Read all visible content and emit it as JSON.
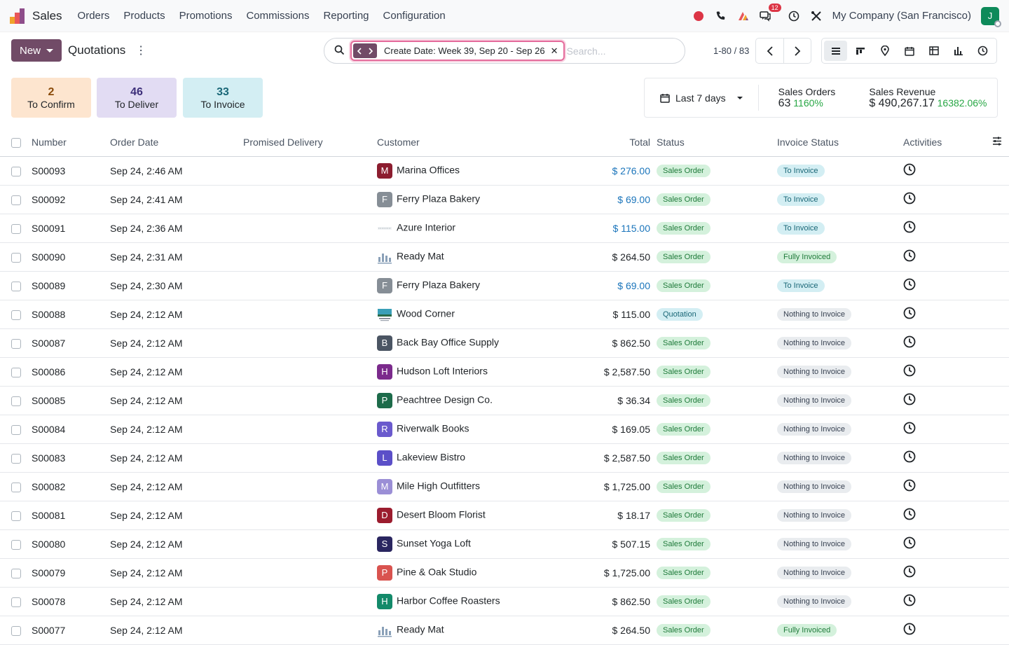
{
  "navbar": {
    "app_name": "Sales",
    "menu": [
      "Orders",
      "Products",
      "Promotions",
      "Commissions",
      "Reporting",
      "Configuration"
    ],
    "messages_count": "12",
    "company": "My Company (San Francisco)",
    "user_initial": "J"
  },
  "control": {
    "new_label": "New",
    "breadcrumb": "Quotations",
    "facet_label": "Create Date: Week 39, Sep 20 - Sep 26",
    "search_placeholder": "Search...",
    "pager": "1-80 / 83"
  },
  "tiles": {
    "confirm": {
      "count": "2",
      "label": "To Confirm"
    },
    "deliver": {
      "count": "46",
      "label": "To Deliver"
    },
    "invoice": {
      "count": "33",
      "label": "To Invoice"
    }
  },
  "kpi": {
    "period": "Last 7 days",
    "orders_label": "Sales Orders",
    "orders_value": "63",
    "orders_pct": "1160%",
    "revenue_label": "Sales Revenue",
    "revenue_value": "$ 490,267.17",
    "revenue_pct": "16382.06%"
  },
  "columns": {
    "number": "Number",
    "order_date": "Order Date",
    "promised": "Promised Delivery",
    "customer": "Customer",
    "total": "Total",
    "status": "Status",
    "invoice_status": "Invoice Status",
    "activities": "Activities"
  },
  "colors": {
    "brand": "#714b67",
    "link_blue": "#1b75bb"
  },
  "rows": [
    {
      "number": "S00093",
      "date": "Sep 24, 2:46 AM",
      "customer": "Marina Offices",
      "initial": "M",
      "avatar_color": "#8c1d2f",
      "total": "$ 276.00",
      "total_blue": true,
      "status": "Sales Order",
      "status_kind": "so",
      "invoice": "To Invoice",
      "invoice_kind": "toinv"
    },
    {
      "number": "S00092",
      "date": "Sep 24, 2:41 AM",
      "customer": "Ferry Plaza Bakery",
      "initial": "F",
      "avatar_color": "#868e96",
      "total": "$ 69.00",
      "total_blue": true,
      "status": "Sales Order",
      "status_kind": "so",
      "invoice": "To Invoice",
      "invoice_kind": "toinv"
    },
    {
      "number": "S00091",
      "date": "Sep 24, 2:36 AM",
      "customer": "Azure Interior",
      "initial": "",
      "avatar_color": "azure",
      "total": "$ 115.00",
      "total_blue": true,
      "status": "Sales Order",
      "status_kind": "so",
      "invoice": "To Invoice",
      "invoice_kind": "toinv"
    },
    {
      "number": "S00090",
      "date": "Sep 24, 2:31 AM",
      "customer": "Ready Mat",
      "initial": "",
      "avatar_color": "readymat",
      "total": "$ 264.50",
      "total_blue": false,
      "status": "Sales Order",
      "status_kind": "so",
      "invoice": "Fully Invoiced",
      "invoice_kind": "full"
    },
    {
      "number": "S00089",
      "date": "Sep 24, 2:30 AM",
      "customer": "Ferry Plaza Bakery",
      "initial": "F",
      "avatar_color": "#868e96",
      "total": "$ 69.00",
      "total_blue": true,
      "status": "Sales Order",
      "status_kind": "so",
      "invoice": "To Invoice",
      "invoice_kind": "toinv"
    },
    {
      "number": "S00088",
      "date": "Sep 24, 2:12 AM",
      "customer": "Wood Corner",
      "initial": "",
      "avatar_color": "wood",
      "total": "$ 115.00",
      "total_blue": false,
      "status": "Quotation",
      "status_kind": "quo",
      "invoice": "Nothing to Invoice",
      "invoice_kind": "noth"
    },
    {
      "number": "S00087",
      "date": "Sep 24, 2:12 AM",
      "customer": "Back Bay Office Supply",
      "initial": "B",
      "avatar_color": "#4b5563",
      "total": "$ 862.50",
      "total_blue": false,
      "status": "Sales Order",
      "status_kind": "so",
      "invoice": "Nothing to Invoice",
      "invoice_kind": "noth"
    },
    {
      "number": "S00086",
      "date": "Sep 24, 2:12 AM",
      "customer": "Hudson Loft Interiors",
      "initial": "H",
      "avatar_color": "#7b2a8c",
      "total": "$ 2,587.50",
      "total_blue": false,
      "status": "Sales Order",
      "status_kind": "so",
      "invoice": "Nothing to Invoice",
      "invoice_kind": "noth"
    },
    {
      "number": "S00085",
      "date": "Sep 24, 2:12 AM",
      "customer": "Peachtree Design Co.",
      "initial": "P",
      "avatar_color": "#1d6b4a",
      "total": "$ 36.34",
      "total_blue": false,
      "status": "Sales Order",
      "status_kind": "so",
      "invoice": "Nothing to Invoice",
      "invoice_kind": "noth"
    },
    {
      "number": "S00084",
      "date": "Sep 24, 2:12 AM",
      "customer": "Riverwalk Books",
      "initial": "R",
      "avatar_color": "#6a5acd",
      "total": "$ 169.05",
      "total_blue": false,
      "status": "Sales Order",
      "status_kind": "so",
      "invoice": "Nothing to Invoice",
      "invoice_kind": "noth"
    },
    {
      "number": "S00083",
      "date": "Sep 24, 2:12 AM",
      "customer": "Lakeview Bistro",
      "initial": "L",
      "avatar_color": "#5b4fc8",
      "total": "$ 2,587.50",
      "total_blue": false,
      "status": "Sales Order",
      "status_kind": "so",
      "invoice": "Nothing to Invoice",
      "invoice_kind": "noth"
    },
    {
      "number": "S00082",
      "date": "Sep 24, 2:12 AM",
      "customer": "Mile High Outfitters",
      "initial": "M",
      "avatar_color": "#9b8fd6",
      "total": "$ 1,725.00",
      "total_blue": false,
      "status": "Sales Order",
      "status_kind": "so",
      "invoice": "Nothing to Invoice",
      "invoice_kind": "noth"
    },
    {
      "number": "S00081",
      "date": "Sep 24, 2:12 AM",
      "customer": "Desert Bloom Florist",
      "initial": "D",
      "avatar_color": "#9b1c2e",
      "total": "$ 18.17",
      "total_blue": false,
      "status": "Sales Order",
      "status_kind": "so",
      "invoice": "Nothing to Invoice",
      "invoice_kind": "noth"
    },
    {
      "number": "S00080",
      "date": "Sep 24, 2:12 AM",
      "customer": "Sunset Yoga Loft",
      "initial": "S",
      "avatar_color": "#2a2660",
      "total": "$ 507.15",
      "total_blue": false,
      "status": "Sales Order",
      "status_kind": "so",
      "invoice": "Nothing to Invoice",
      "invoice_kind": "noth"
    },
    {
      "number": "S00079",
      "date": "Sep 24, 2:12 AM",
      "customer": "Pine & Oak Studio",
      "initial": "P",
      "avatar_color": "#d9534f",
      "total": "$ 1,725.00",
      "total_blue": false,
      "status": "Sales Order",
      "status_kind": "so",
      "invoice": "Nothing to Invoice",
      "invoice_kind": "noth"
    },
    {
      "number": "S00078",
      "date": "Sep 24, 2:12 AM",
      "customer": "Harbor Coffee Roasters",
      "initial": "H",
      "avatar_color": "#138a6a",
      "total": "$ 862.50",
      "total_blue": false,
      "status": "Sales Order",
      "status_kind": "so",
      "invoice": "Nothing to Invoice",
      "invoice_kind": "noth"
    },
    {
      "number": "S00077",
      "date": "Sep 24, 2:12 AM",
      "customer": "Ready Mat",
      "initial": "",
      "avatar_color": "readymat",
      "total": "$ 264.50",
      "total_blue": false,
      "status": "Sales Order",
      "status_kind": "so",
      "invoice": "Fully Invoiced",
      "invoice_kind": "full"
    }
  ]
}
